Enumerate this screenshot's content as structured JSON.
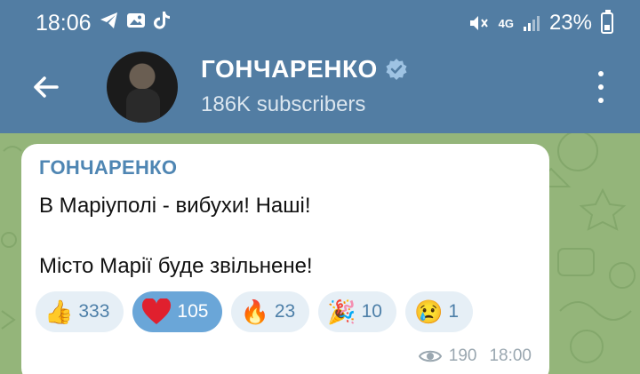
{
  "status_bar": {
    "time": "18:06",
    "network": "4G",
    "battery": "23%"
  },
  "header": {
    "channel_name": "ГОНЧАРЕНКО",
    "subscribers": "186K subscribers",
    "verified": true
  },
  "message": {
    "sender": "ГОНЧАРЕНКО",
    "line1": "В Маріуполі - вибухи! Наші!",
    "line2": "Місто Марії буде звільнене!",
    "views": "190",
    "time": "18:00",
    "reactions": [
      {
        "emoji": "👍",
        "icon": "thumbs-up-icon",
        "count": "333",
        "active": false
      },
      {
        "emoji": "❤️",
        "icon": "heart-icon",
        "count": "105",
        "active": true
      },
      {
        "emoji": "🔥",
        "icon": "fire-icon",
        "count": "23",
        "active": false
      },
      {
        "emoji": "🎉",
        "icon": "party-popper-icon",
        "count": "10",
        "active": false
      },
      {
        "emoji": "😢",
        "icon": "crying-face-icon",
        "count": "1",
        "active": false
      }
    ]
  },
  "colors": {
    "header_bg": "#527da3",
    "chat_bg": "#94b57a",
    "accent": "#4f86b3",
    "reaction_bg": "#e6eff6",
    "reaction_active_bg": "#6aa6d8"
  }
}
